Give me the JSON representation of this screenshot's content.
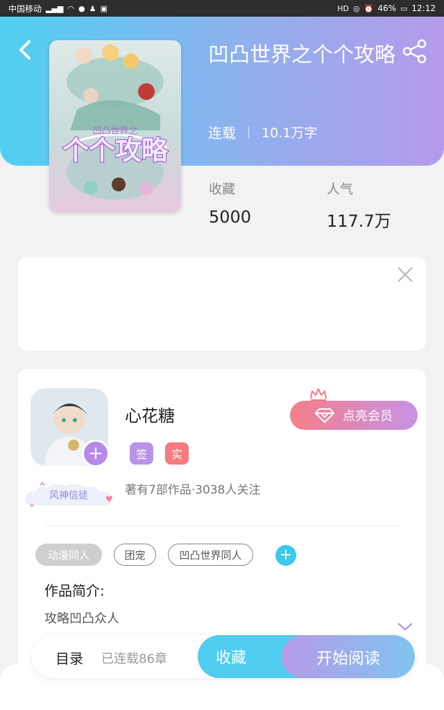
{
  "status_bar": {
    "carrier": "中国移动",
    "signal_text": "⁴⁶",
    "battery": "46%",
    "time": "12:12"
  },
  "book": {
    "title": "凹凸世界之个个攻略",
    "status": "连载",
    "word_count": "10.1万字",
    "stats": [
      {
        "label": "收藏",
        "value": "5000"
      },
      {
        "label": "人气",
        "value": "117.7万"
      }
    ],
    "cover_title": "个个攻略",
    "cover_small": "凹凸世界之"
  },
  "author": {
    "name": "心花糖",
    "badge_sign": "签",
    "badge_real": "实",
    "fans_badge": "风神信徒",
    "stats_text": "著有7部作品·3038人关注",
    "vip_button": "点亮会员"
  },
  "tags": [
    "动漫同人",
    "团宠",
    "凹凸世界同人"
  ],
  "intro": {
    "heading": "作品简介:",
    "text": "攻略凹凸众人"
  },
  "bottom": {
    "toc_label": "目录",
    "toc_status": "已连载86章",
    "favorite_button": "收藏",
    "read_button": "开始阅读"
  },
  "colors": {
    "hero_start": "#4ed0f1",
    "hero_end": "#b49aec",
    "accent_blue": "#4fcdf0",
    "accent_purple": "#b88ae8",
    "accent_red": "#f47b7f"
  }
}
